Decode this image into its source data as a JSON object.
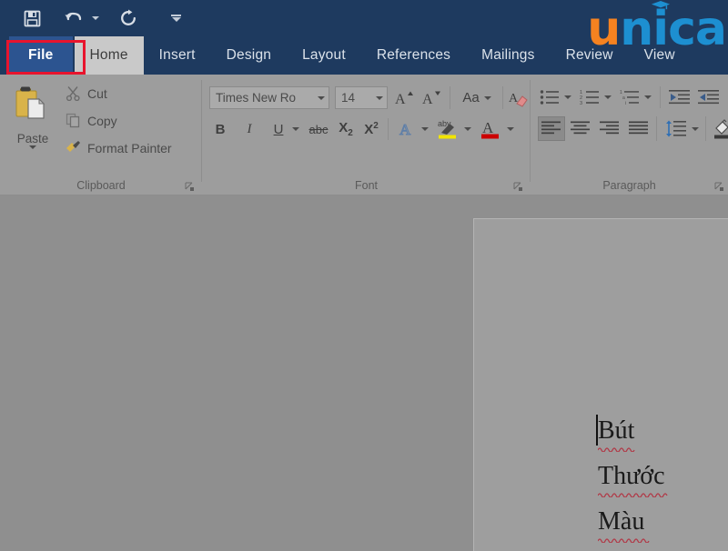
{
  "app": {
    "theme_dark_blue": "#1e3a5f",
    "accent_blue": "#2c5490",
    "annotation_color": "#e8142d",
    "ribbon_gray": "#9d9d9d"
  },
  "quick_access": {
    "items": [
      {
        "name": "save-button",
        "icon": "save-icon",
        "label": "Save"
      },
      {
        "name": "undo-button",
        "icon": "undo-icon",
        "label": "Undo"
      },
      {
        "name": "redo-button",
        "icon": "redo-icon",
        "label": "Redo"
      },
      {
        "name": "customize-qat-button",
        "icon": "chevron-down-icon",
        "label": "Customize Quick Access Toolbar"
      }
    ]
  },
  "tabs": [
    {
      "label": "File",
      "active": false,
      "is_file": true,
      "highlighted": true
    },
    {
      "label": "Home",
      "active": true,
      "is_file": false,
      "highlighted": false
    },
    {
      "label": "Insert",
      "active": false,
      "is_file": false,
      "highlighted": false
    },
    {
      "label": "Design",
      "active": false,
      "is_file": false,
      "highlighted": false
    },
    {
      "label": "Layout",
      "active": false,
      "is_file": false,
      "highlighted": false
    },
    {
      "label": "References",
      "active": false,
      "is_file": false,
      "highlighted": false
    },
    {
      "label": "Mailings",
      "active": false,
      "is_file": false,
      "highlighted": false
    },
    {
      "label": "Review",
      "active": false,
      "is_file": false,
      "highlighted": false
    },
    {
      "label": "View",
      "active": false,
      "is_file": false,
      "highlighted": false
    }
  ],
  "logo": {
    "text": "unica",
    "letters": {
      "u": "u",
      "n": "n",
      "i": "i",
      "c": "c",
      "a": "a"
    },
    "orange": "#f58220",
    "blue": "#1d8fd1",
    "cap_icon": "graduation-cap-icon"
  },
  "ribbon": {
    "groups": [
      {
        "name": "clipboard",
        "label": "Clipboard",
        "paste": {
          "label": "Paste",
          "icon": "paste-icon"
        },
        "items": [
          {
            "label": "Cut",
            "icon": "scissors-icon"
          },
          {
            "label": "Copy",
            "icon": "copy-icon"
          },
          {
            "label": "Format Painter",
            "icon": "format-painter-icon"
          }
        ],
        "launcher": "dialog-launcher-icon"
      },
      {
        "name": "font",
        "label": "Font",
        "font_name": {
          "value": "Times New Ro",
          "placeholder": "Font"
        },
        "font_size": {
          "value": "14",
          "placeholder": "Size"
        },
        "buttons": [
          {
            "label": "A",
            "icon": "grow-font-icon"
          },
          {
            "label": "A",
            "icon": "shrink-font-icon"
          },
          {
            "label": "Aa",
            "icon": "change-case-icon"
          },
          {
            "label": "A",
            "icon": "clear-formatting-icon"
          },
          {
            "label": "B",
            "icon": "bold-icon"
          },
          {
            "label": "I",
            "icon": "italic-icon"
          },
          {
            "label": "U",
            "icon": "underline-icon"
          },
          {
            "label": "abc",
            "icon": "strikethrough-icon"
          },
          {
            "label": "X",
            "icon": "subscript-icon"
          },
          {
            "label": "X",
            "icon": "superscript-icon"
          },
          {
            "label": "A",
            "icon": "text-effects-icon"
          },
          {
            "label": "aby",
            "icon": "text-highlight-icon"
          },
          {
            "label": "A",
            "icon": "font-color-icon"
          }
        ],
        "highlight_color": "#f2e500",
        "font_color": "#cc0000",
        "launcher": "dialog-launcher-icon"
      },
      {
        "name": "paragraph",
        "label": "Paragraph",
        "buttons": [
          {
            "icon": "bullets-icon"
          },
          {
            "icon": "numbering-icon"
          },
          {
            "icon": "multilevel-list-icon"
          },
          {
            "icon": "decrease-indent-icon"
          },
          {
            "icon": "increase-indent-icon"
          },
          {
            "icon": "align-left-icon",
            "selected": true
          },
          {
            "icon": "align-center-icon"
          },
          {
            "icon": "align-right-icon"
          },
          {
            "icon": "justify-icon"
          },
          {
            "icon": "line-spacing-icon"
          },
          {
            "icon": "shading-icon"
          },
          {
            "icon": "borders-icon"
          }
        ],
        "launcher": "dialog-launcher-icon"
      }
    ]
  },
  "document": {
    "lines": [
      {
        "text": "Bút",
        "misspelled": true
      },
      {
        "text": "Thước",
        "misspelled": true
      },
      {
        "text": "Màu",
        "misspelled": true
      }
    ],
    "cursor_visible": true,
    "spellcheck_color": "#b03a48"
  }
}
